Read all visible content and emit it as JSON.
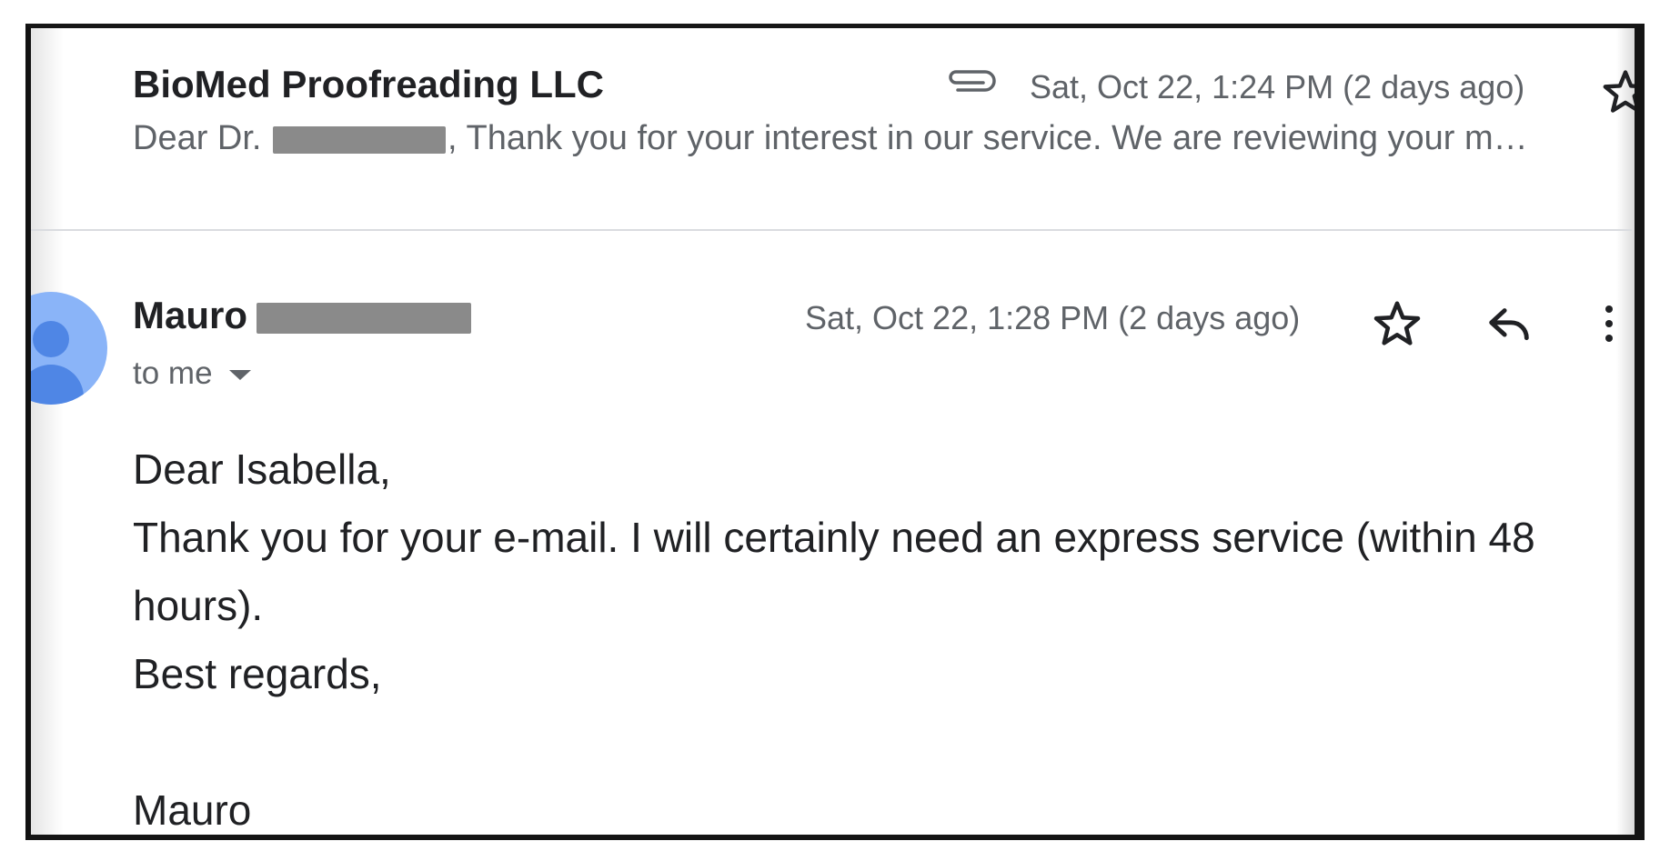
{
  "thread": {
    "messages": [
      {
        "sender": "BioMed Proofreading LLC",
        "snippet_prefix": "Dear Dr.",
        "snippet_suffix": ", Thank you for your interest in our service. We are reviewing your m…",
        "date": "Sat, Oct 22, 1:24 PM (2 days ago)",
        "has_attachment": true,
        "icons": [
          "paperclip-icon",
          "star-icon"
        ]
      },
      {
        "sender_first": "Mauro",
        "recipient_label": "to me",
        "date": "Sat, Oct 22, 1:28 PM (2 days ago)",
        "icons": [
          "avatar",
          "star-icon",
          "reply-icon",
          "more-vert-icon"
        ],
        "body": {
          "greeting": "Dear Isabella,",
          "line1": "Thank you for your e-mail. I will certainly need an express service (within 48 hours).",
          "closing": "Best regards,",
          "signature": "Mauro"
        }
      }
    ]
  },
  "colors": {
    "text_primary": "#202124",
    "text_secondary": "#5f6368",
    "redaction": "#8a8a8a",
    "avatar_bg": "#8ab4f8",
    "avatar_fg": "#4f86e5",
    "divider": "#dadce0"
  }
}
